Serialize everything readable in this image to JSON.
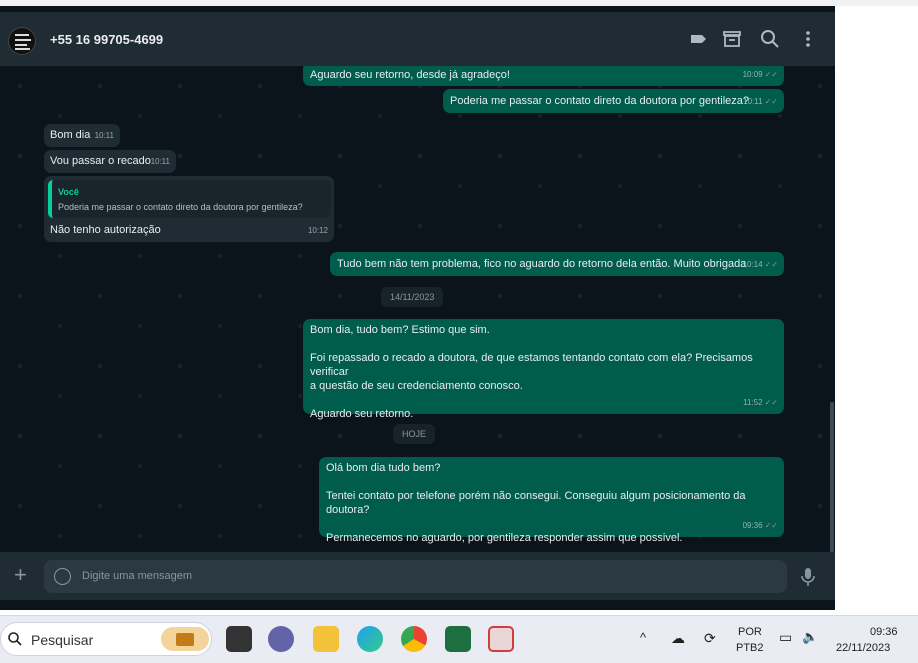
{
  "contact": {
    "phone": "+55 16 99705-4699"
  },
  "messages": [
    {
      "text": "Aguardo seu retorno, desde já agradeço!",
      "time": "10:09"
    },
    {
      "text": "Poderia me passar o contato direto da doutora por gentileza?",
      "time": "10:11"
    },
    {
      "text": "Bom dia",
      "time": "10:11"
    },
    {
      "text": "Vou passar o recado",
      "time": "10:11"
    },
    {
      "quote_author": "Você",
      "quote_text": "Poderia me passar o contato direto da doutora por gentileza?",
      "text": "Não tenho autorização",
      "time": "10:12"
    },
    {
      "text": "Tudo bem não tem problema, fico no aguardo do retorno dela então. Muito obrigada",
      "time": "10:14"
    },
    {
      "text": "Bom dia, tudo bem? Estimo que sim.\n\nFoi repassado o recado a doutora, de que estamos tentando contato com ela? Precisamos verificar\na questão de seu credenciamento conosco.\n\nAguardo seu retorno.",
      "time": "11:52"
    },
    {
      "text": "Olá bom dia tudo bem?\n\nTentei contato por telefone porém não consegui. Conseguiu algum posicionamento da doutora?\n\nPermanecemos no aguardo, por gentileza responder assim que possivel.",
      "time": "09:36"
    }
  ],
  "dates": {
    "d1": "14/11/2023",
    "d2": "HOJE"
  },
  "composer": {
    "placeholder": "Digite uma mensagem"
  },
  "taskbar": {
    "search_placeholder": "Pesquisar",
    "lang_line1": "POR",
    "lang_line2": "PTB2",
    "time": "09:36",
    "date": "22/11/2023"
  },
  "colors": {
    "outgoing": "#005c4b",
    "incoming": "#202c33",
    "background": "#0b141a",
    "accent": "#06cf9c"
  },
  "icons": [
    "label-icon",
    "store-icon",
    "search-icon",
    "menu-icon",
    "plus-icon",
    "emoji-icon",
    "mic-icon",
    "double-check-icon"
  ]
}
